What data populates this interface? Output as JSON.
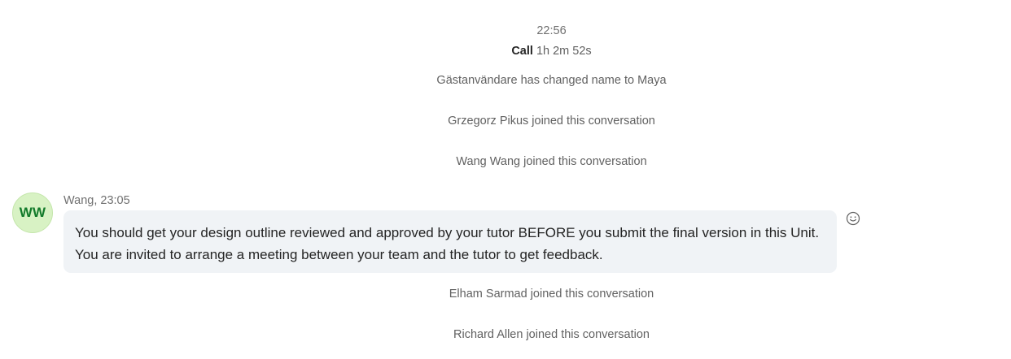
{
  "timeline": {
    "timestamp": "22:56",
    "call_label": "Call",
    "call_duration": "1h 2m 52s"
  },
  "events": [
    "Gästanvändare has changed name to Maya",
    "Grzegorz Pikus joined this conversation",
    "Wang Wang joined this conversation",
    "Elham Sarmad joined this conversation",
    "Richard Allen joined this conversation"
  ],
  "message": {
    "avatar_initials": "WW",
    "meta": "Wang, 23:05",
    "lines": [
      "You should get your design outline reviewed and approved by your tutor BEFORE you submit the final version in this Unit.",
      "You are invited to arrange a meeting between your team and the tutor to get feedback."
    ],
    "reaction_icon": "smiley-reaction-icon"
  },
  "colors": {
    "avatar_bg": "#d8f2c4",
    "avatar_text": "#127a2a",
    "bubble_bg": "#f0f3f6",
    "system_text": "#616161"
  }
}
